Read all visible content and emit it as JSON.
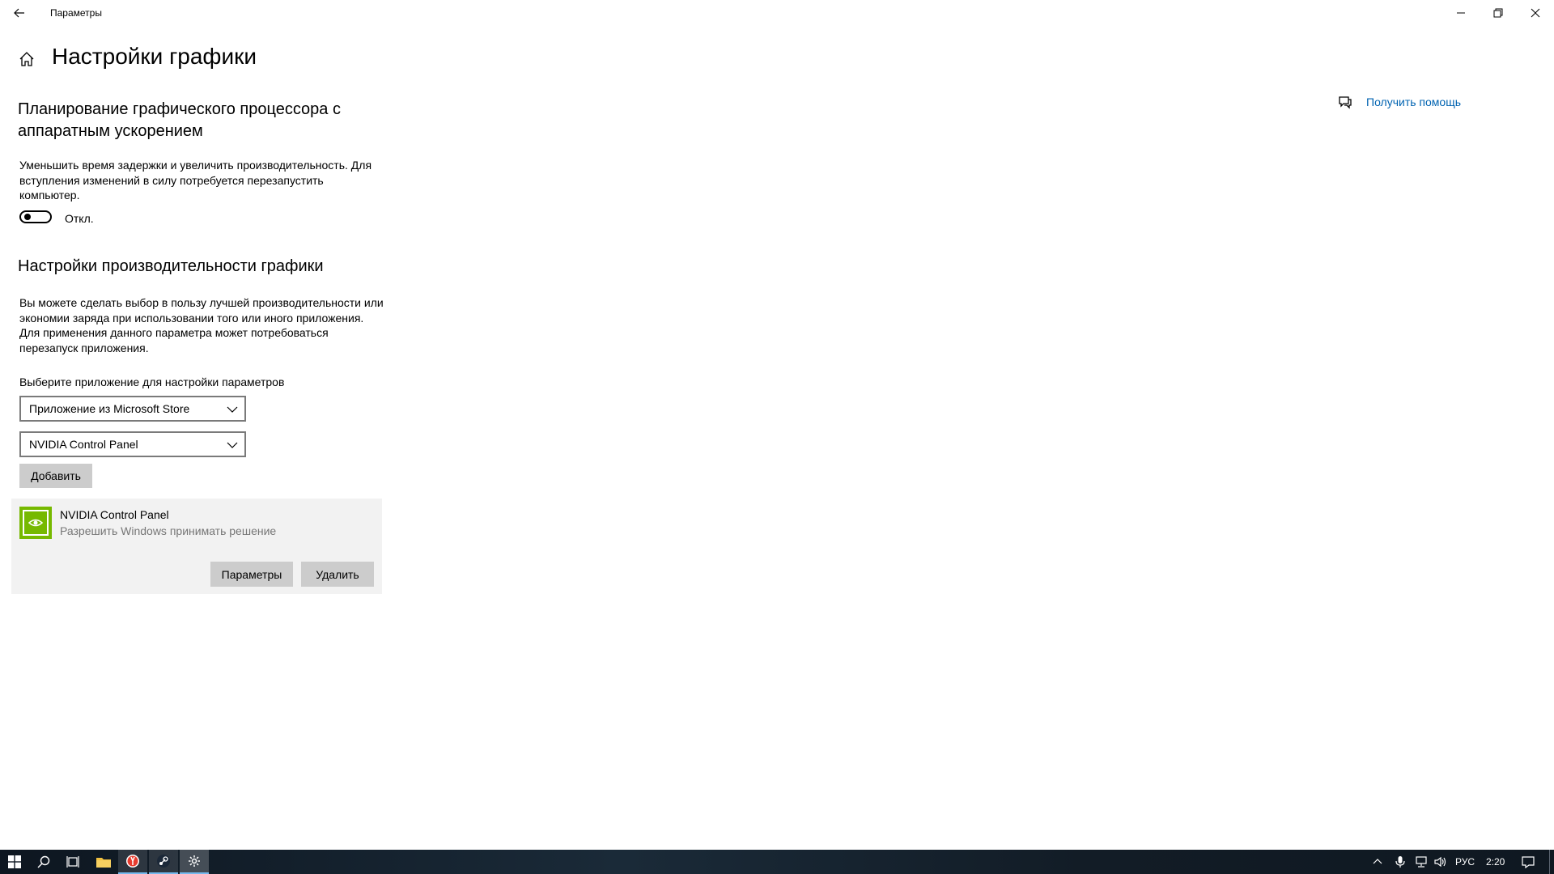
{
  "window": {
    "title": "Параметры"
  },
  "header": {
    "page_title": "Настройки графики"
  },
  "gpu_scheduling": {
    "title_line1": "Планирование графического процессора с",
    "title_line2": "аппаратным ускорением",
    "desc_line1": "Уменьшить время задержки и увеличить производительность. Для",
    "desc_line2": "вступления изменений в силу потребуется перезапустить",
    "desc_line3": "компьютер.",
    "toggle_state": "Откл."
  },
  "performance": {
    "title": "Настройки производительности графики",
    "desc_line1": "Вы можете сделать выбор в пользу лучшей производительности или",
    "desc_line2": "экономии заряда при использовании того или иного приложения.",
    "desc_line3": "Для применения данного параметра может потребоваться",
    "desc_line4": "перезапуск приложения.",
    "select_label": "Выберите приложение для настройки параметров",
    "app_type_selected": "Приложение из Microsoft Store",
    "app_selected": "NVIDIA Control Panel",
    "add_button": "Добавить"
  },
  "app_card": {
    "name": "NVIDIA Control Panel",
    "preference": "Разрешить Windows принимать решение",
    "options_button": "Параметры",
    "remove_button": "Удалить"
  },
  "help": {
    "link": "Получить помощь"
  },
  "taskbar": {
    "language": "РУС",
    "time": "2:20"
  },
  "colors": {
    "accent": "#0063b1",
    "nvidia_green": "#76b900",
    "button_gray": "#cccccc",
    "card_gray": "#f2f2f2"
  }
}
